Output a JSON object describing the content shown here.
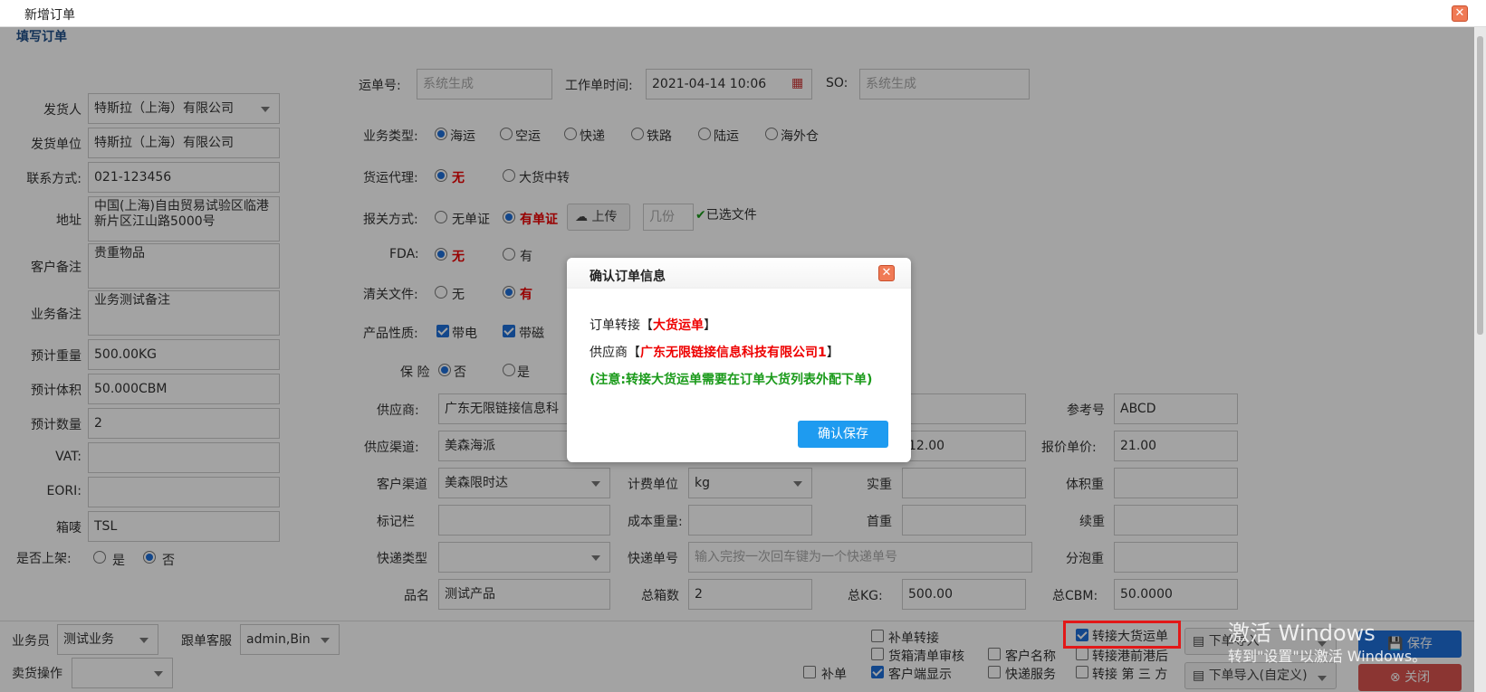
{
  "window": {
    "title": "新增订单"
  },
  "section_title": "填写订单",
  "left": [
    {
      "key": "shipper",
      "label": "发货人",
      "value": "特斯拉（上海）有限公司",
      "dropdown": true
    },
    {
      "key": "ship_unit",
      "label": "发货单位",
      "value": "特斯拉（上海）有限公司"
    },
    {
      "key": "contact",
      "label": "联系方式:",
      "value": "021-123456"
    },
    {
      "key": "address",
      "label": "地址",
      "value": "中国(上海)自由贸易试验区临港新片区江山路5000号",
      "multiline": true
    },
    {
      "key": "cust_note",
      "label": "客户备注",
      "value": "贵重物品",
      "multiline": true
    },
    {
      "key": "biz_note",
      "label": "业务备注",
      "value": "业务测试备注",
      "multiline": true
    },
    {
      "key": "est_weight",
      "label": "预计重量",
      "value": "500.00KG"
    },
    {
      "key": "est_volume",
      "label": "预计体积",
      "value": "50.000CBM"
    },
    {
      "key": "est_qty",
      "label": "预计数量",
      "value": "2"
    },
    {
      "key": "vat",
      "label": "VAT:",
      "value": ""
    },
    {
      "key": "eori",
      "label": "EORI:",
      "value": ""
    },
    {
      "key": "mark",
      "label": "箱唛",
      "value": "TSL"
    }
  ],
  "shelf": {
    "label": "是否上架:",
    "yes": "是",
    "no": "否"
  },
  "form": {
    "waybill_label": "运单号:",
    "waybill_ph": "系统生成",
    "worktime_label": "工作单时间:",
    "worktime_value": "2021-04-14 10:06",
    "so_label": "SO:",
    "so_ph": "系统生成",
    "biz_label": "业务类型:",
    "biz_opts": [
      "海运",
      "空运",
      "快递",
      "铁路",
      "陆运",
      "海外仓"
    ],
    "agent_label": "货运代理:",
    "agent_opts": [
      "无",
      "大货中转"
    ],
    "customs_label": "报关方式:",
    "customs_opts": [
      "无单证",
      "有单证"
    ],
    "upload": "上传",
    "copies_ph": "几份",
    "file_status": "已选文件",
    "fda_label": "FDA:",
    "fda_opts": [
      "无",
      "有"
    ],
    "clear_label": "清关文件:",
    "clear_opts": [
      "无",
      "有"
    ],
    "prop_label": "产品性质:",
    "prop_opts": [
      "带电",
      "带磁"
    ],
    "ins_label": "保 险",
    "ins_opts": [
      "否",
      "是"
    ],
    "supplier_label": "供应商:",
    "supplier_value": "广东无限链接信息科",
    "ref_label": "参考号",
    "ref_value": "ABCD",
    "channel_label": "供应渠道:",
    "channel_value": "美森海派",
    "price_value": "12.00",
    "quote_label": "报价单价:",
    "quote_value": "21.00",
    "cust_channel_label": "客户渠道",
    "cust_channel_value": "美森限时达",
    "unit_label": "计费单位",
    "unit_value": "kg",
    "actual_label": "实重",
    "volw_label": "体积重",
    "remark_label": "标记栏",
    "cost_label": "成本重量:",
    "first_label": "首重",
    "cont_label": "续重",
    "exp_type_label": "快递类型",
    "exp_no_label": "快递单号",
    "exp_no_ph": "输入完按一次回车键为一个快递单号",
    "bubble_label": "分泡重",
    "product_label": "品名",
    "product_value": "测试产品",
    "boxes_label": "总箱数",
    "boxes_value": "2",
    "kg_label": "总KG:",
    "kg_value": "500.00",
    "cbm_label": "总CBM:",
    "cbm_value": "50.0000"
  },
  "bottom": {
    "sales_label": "业务员",
    "sales_value": "测试业务",
    "cs_label": "跟单客服",
    "cs_value": "admin,Bin",
    "sell_label": "卖货操作",
    "cb_resupply_transfer": "补单转接",
    "cb_packing_audit": "货箱清单审核",
    "cb_customer_name": "客户名称",
    "cb_resupply": "补单",
    "cb_client_show": "客户端显示",
    "cb_express": "快递服务",
    "cb_bulk": "转接大货运单",
    "cb_port": "转接港前港后",
    "cb_third": "转接 第 三 方",
    "import1": "下单导入",
    "import2": "下单导入(自定义)",
    "save": "保存",
    "close": "关闭"
  },
  "dialog": {
    "title": "确认订单信息",
    "line1_pre": "订单转接【",
    "line1_val": "大货运单",
    "line1_post": "】",
    "line2_pre": "供应商【",
    "line2_val": "广东无限链接信息科技有限公司1",
    "line2_post": "】",
    "note": "(注意:转接大货运单需要在订单大货列表外配下单)",
    "confirm": "确认保存"
  },
  "watermark": {
    "line1": "激活 Windows",
    "line2": "转到\"设置\"以激活 Windows。"
  },
  "colors": {
    "accent": "#1e9bf0",
    "danger": "#e21818",
    "note": "#1a9a1a"
  }
}
